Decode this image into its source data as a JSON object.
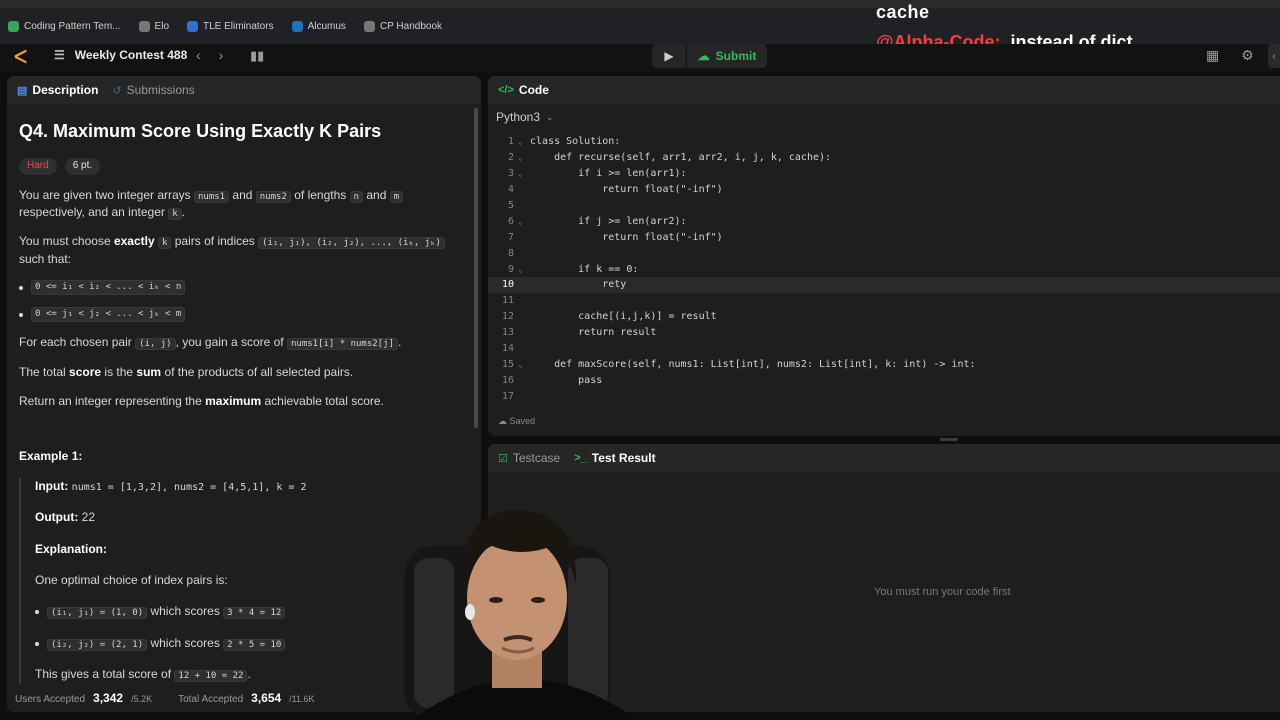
{
  "bookmarks": [
    {
      "label": "Coding Pattern Tem...",
      "icon": "green-logo-icon",
      "color": "#34a853"
    },
    {
      "label": "Elo",
      "icon": "globe-icon",
      "color": "#777777"
    },
    {
      "label": "TLE Eliminators",
      "icon": "tle-logo-icon",
      "color": "#2f6fd6"
    },
    {
      "label": "Alcumus",
      "icon": "alcumus-logo-icon",
      "color": "#1e73be"
    },
    {
      "label": "CP Handbook",
      "icon": "globe-icon",
      "color": "#777777"
    }
  ],
  "overlay": {
    "cache": "cache",
    "handle": "@Alpha-Code:",
    "text": "instead of dict"
  },
  "nav": {
    "contest_title": "Weekly Contest 488",
    "submit_label": "Submit"
  },
  "left": {
    "tabs": {
      "description": "Description",
      "submissions": "Submissions"
    },
    "title": "Q4. Maximum Score Using Exactly K Pairs",
    "difficulty": "Hard",
    "points": "6 pt.",
    "p1": {
      "a": "You are given two integer arrays ",
      "nums1": "nums1",
      "and1": " and ",
      "nums2": "nums2",
      "of": " of lengths ",
      "n": "n",
      "and2": " and ",
      "m": "m",
      "rest": "respectively, and an integer ",
      "k": "k",
      "end": "."
    },
    "p2": {
      "a": "You must choose ",
      "exactly": "exactly",
      "k": "k",
      "b": " pairs of indices ",
      "pairs": "(i₁, j₁), (i₂, j₂), ..., (iₖ, jₖ)",
      "c": "such that:"
    },
    "constraints": [
      "0 <= i₁ < i₂ < ... < iₖ < n",
      "0 <= j₁ < j₂ < ... < jₖ < m"
    ],
    "p3": {
      "a": "For each chosen pair ",
      "pair": "(i, j)",
      "b": ", you gain a score of ",
      "expr": "nums1[i] * nums2[j]",
      "c": "."
    },
    "p4": {
      "a": "The total ",
      "score": "score",
      "b": " is the ",
      "sum": "sum",
      "c": " of the products of all selected pairs."
    },
    "p5": {
      "a": "Return an integer representing the ",
      "maximum": "maximum",
      "b": " achievable total score."
    },
    "example": {
      "title": "Example 1:",
      "input_label": "Input:",
      "input": "nums1 = [1,3,2], nums2 = [4,5,1], k = 2",
      "output_label": "Output:",
      "output": "22",
      "explanation_label": "Explanation:",
      "optimal": "One optimal choice of index pairs is:",
      "choices": [
        {
          "pair": "(i₁, j₁) = (1, 0)",
          "text": " which scores ",
          "calc": "3 * 4 = 12"
        },
        {
          "pair": "(i₂, j₂) = (2, 1)",
          "text": " which scores ",
          "calc": "2 * 5 = 10"
        }
      ],
      "total_text": "This gives a total score of ",
      "total_calc": "12 + 10 = 22",
      "total_end": "."
    },
    "stats": {
      "users_label": "Users Accepted",
      "users_value": "3,342",
      "users_total": "/5.2K",
      "total_label": "Total Accepted",
      "total_value": "3,654",
      "total_total": "/11.6K"
    }
  },
  "code": {
    "header": "Code",
    "language": "Python3",
    "current_line": 10,
    "lines": [
      {
        "n": "1",
        "fold": "⌄",
        "t": "class Solution:"
      },
      {
        "n": "2",
        "fold": "⌄",
        "t": "    def recurse(self, arr1, arr2, i, j, k, cache):"
      },
      {
        "n": "3",
        "fold": "⌄",
        "t": "        if i >= len(arr1):"
      },
      {
        "n": "4",
        "fold": "",
        "t": "            return float(\"-inf\")"
      },
      {
        "n": "5",
        "fold": "",
        "t": ""
      },
      {
        "n": "6",
        "fold": "⌄",
        "t": "        if j >= len(arr2):"
      },
      {
        "n": "7",
        "fold": "",
        "t": "            return float(\"-inf\")"
      },
      {
        "n": "8",
        "fold": "",
        "t": ""
      },
      {
        "n": "9",
        "fold": "⌄",
        "t": "        if k == 0:"
      },
      {
        "n": "10",
        "fold": "",
        "t": "            rety"
      },
      {
        "n": "11",
        "fold": "",
        "t": ""
      },
      {
        "n": "12",
        "fold": "",
        "t": "        cache[(i,j,k)] = result"
      },
      {
        "n": "13",
        "fold": "",
        "t": "        return result"
      },
      {
        "n": "14",
        "fold": "",
        "t": ""
      },
      {
        "n": "15",
        "fold": "⌄",
        "t": "    def maxScore(self, nums1: List[int], nums2: List[int], k: int) -> int:"
      },
      {
        "n": "16",
        "fold": "",
        "t": "        pass"
      },
      {
        "n": "17",
        "fold": "",
        "t": ""
      }
    ],
    "saved": "Saved"
  },
  "test": {
    "testcase_tab": "Testcase",
    "result_tab": "Test Result",
    "empty_message": "You must run your code first"
  }
}
